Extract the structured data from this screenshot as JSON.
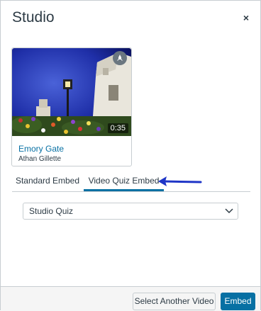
{
  "dialog": {
    "title": "Studio",
    "close_icon": "close-icon",
    "close_glyph": "×"
  },
  "video": {
    "title": "Emory Gate",
    "author": "Athan Gillette",
    "duration": "0:35",
    "badge_icon": "rocket-icon"
  },
  "tabs": [
    {
      "label": "Standard Embed",
      "selected": false
    },
    {
      "label": "Video Quiz Embed",
      "selected": true
    }
  ],
  "quiz_select": {
    "value": "Studio Quiz",
    "chevron_icon": "chevron-down-icon"
  },
  "footer": {
    "select_another_label": "Select Another Video",
    "embed_label": "Embed"
  },
  "colors": {
    "accent": "#0770a3",
    "text": "#2d3b45",
    "border": "#c7cdd1",
    "annotation_arrow": "#1f36c7"
  }
}
